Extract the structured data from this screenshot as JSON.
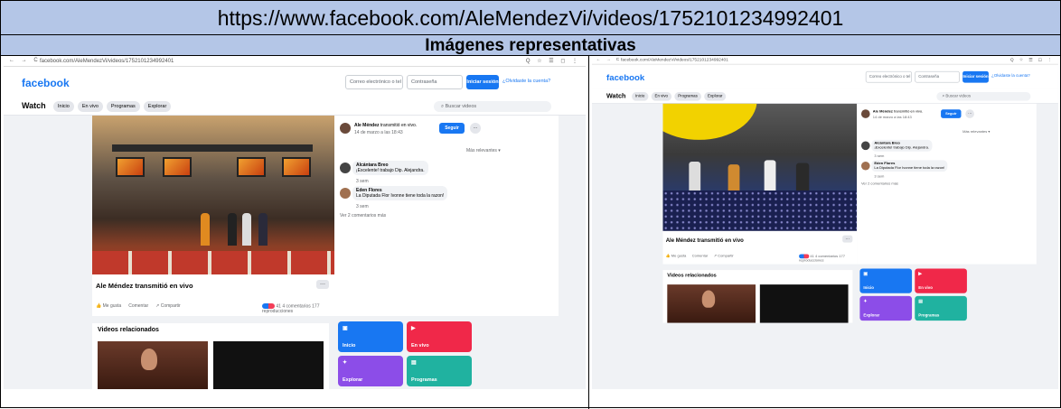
{
  "header": {
    "url": "https://www.facebook.com/AleMendezVi/videos/1752101234992401",
    "label": "Imágenes representativas"
  },
  "browser": {
    "address": "facebook.com/AleMendezVi/videos/1752101234992401",
    "nav": "← → C",
    "tools": "Q ☆ ☰ ◻ ⋮"
  },
  "fb": {
    "logo": "facebook",
    "email_placeholder": "Correo electrónico o tel",
    "password_placeholder": "Contraseña",
    "login": "Iniciar sesión",
    "forgot": "¿Olvidaste la cuenta?",
    "watch": "Watch",
    "tabs": [
      "Inicio",
      "En vivo",
      "Programas",
      "Explorar"
    ],
    "search_placeholder": "Buscar videos"
  },
  "video": {
    "title": "Ale Méndez transmitió en vivo",
    "more": "···",
    "like": "Me gusta",
    "comment": "Comentar",
    "share": "Compartir",
    "reactions_count": "41",
    "comments_count": "4 comentarios",
    "views": "177 reproducciones"
  },
  "sidebar": {
    "author": "Ale Méndez",
    "author_action": "transmitió en vivo.",
    "date": "14 de marzo a las 18:43",
    "follow": "Seguir",
    "sort": "Más relevantes",
    "comments": [
      {
        "name": "Alcántara Breo",
        "text": "¡Excelente! trabajo Dip. Alejandra.",
        "age": "3 sem"
      },
      {
        "name": "Eden Flores",
        "text": "La Diputada Flor Ivonne tiene toda la razon!",
        "age": "3 sem"
      }
    ],
    "more_comments": "Ver 2 comentarios más"
  },
  "related": {
    "title": "Videos relacionados",
    "tiles": [
      {
        "label": "Inicio",
        "color": "#1877f2"
      },
      {
        "label": "En vivo",
        "color": "#f02849"
      },
      {
        "label": "Explorar",
        "color": "#8c4de8"
      },
      {
        "label": "Programas",
        "color": "#20b2a0"
      }
    ]
  }
}
